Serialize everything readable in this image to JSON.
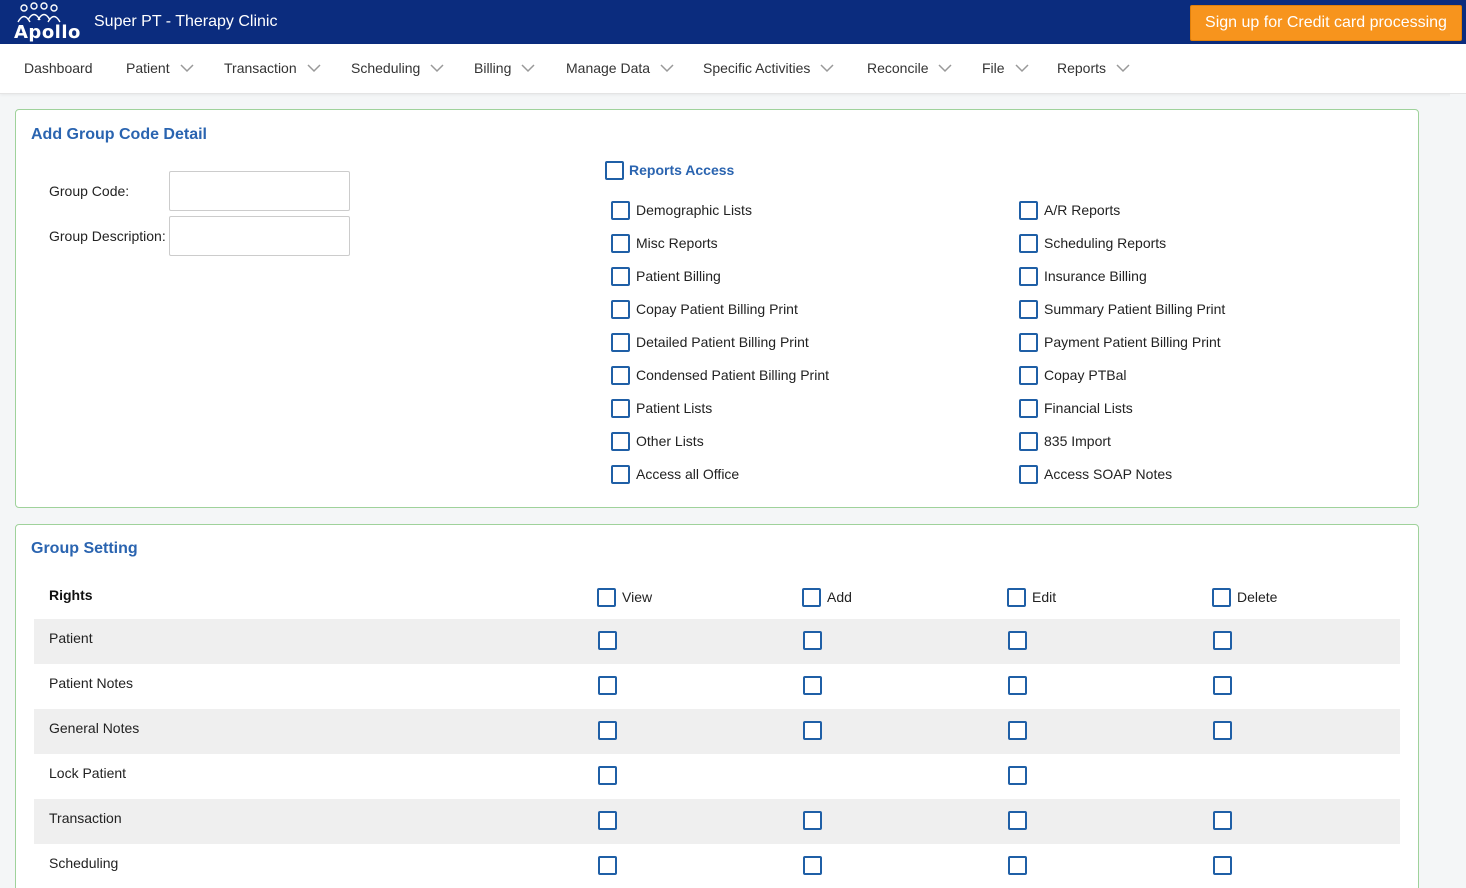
{
  "header": {
    "logo_text": "Apollo",
    "clinic_title": "Super PT - Therapy Clinic",
    "signup_label": "Sign up for Credit card processing"
  },
  "nav": {
    "items": [
      {
        "label": "Dashboard",
        "has_dropdown": false
      },
      {
        "label": "Patient",
        "has_dropdown": true
      },
      {
        "label": "Transaction",
        "has_dropdown": true
      },
      {
        "label": "Scheduling",
        "has_dropdown": true
      },
      {
        "label": "Billing",
        "has_dropdown": true
      },
      {
        "label": "Manage Data",
        "has_dropdown": true
      },
      {
        "label": "Specific Activities",
        "has_dropdown": true
      },
      {
        "label": "Reconcile",
        "has_dropdown": true
      },
      {
        "label": "File",
        "has_dropdown": true
      },
      {
        "label": "Reports",
        "has_dropdown": true
      }
    ]
  },
  "group_detail": {
    "title": "Add Group Code Detail",
    "group_code_label": "Group Code:",
    "group_code_value": "",
    "group_desc_label": "Group Description:",
    "group_desc_value": "",
    "reports_access_label": "Reports Access",
    "reports_access_checked": false,
    "left_options": [
      {
        "label": "Demographic Lists",
        "checked": false
      },
      {
        "label": "Misc Reports",
        "checked": false
      },
      {
        "label": "Patient Billing",
        "checked": false
      },
      {
        "label": "Copay Patient Billing Print",
        "checked": false
      },
      {
        "label": "Detailed Patient Billing Print",
        "checked": false
      },
      {
        "label": "Condensed Patient Billing Print",
        "checked": false
      },
      {
        "label": "Patient Lists",
        "checked": false
      },
      {
        "label": "Other Lists",
        "checked": false
      },
      {
        "label": "Access all Office",
        "checked": false
      }
    ],
    "right_options": [
      {
        "label": "A/R Reports",
        "checked": false
      },
      {
        "label": "Scheduling Reports",
        "checked": false
      },
      {
        "label": "Insurance Billing",
        "checked": false
      },
      {
        "label": "Summary Patient Billing Print",
        "checked": false
      },
      {
        "label": "Payment Patient Billing Print",
        "checked": false
      },
      {
        "label": "Copay PTBal",
        "checked": false
      },
      {
        "label": "Financial Lists",
        "checked": false
      },
      {
        "label": "835 Import",
        "checked": false
      },
      {
        "label": "Access SOAP Notes",
        "checked": false
      }
    ]
  },
  "group_setting": {
    "title": "Group Setting",
    "rights_header": "Rights",
    "columns": [
      "View",
      "Add",
      "Edit",
      "Delete"
    ],
    "rows": [
      {
        "label": "Patient",
        "has": [
          true,
          true,
          true,
          true
        ]
      },
      {
        "label": "Patient Notes",
        "has": [
          true,
          true,
          true,
          true
        ]
      },
      {
        "label": "General Notes",
        "has": [
          true,
          true,
          true,
          true
        ]
      },
      {
        "label": "Lock Patient",
        "has": [
          true,
          false,
          true,
          false
        ]
      },
      {
        "label": "Transaction",
        "has": [
          true,
          true,
          true,
          true
        ]
      },
      {
        "label": "Scheduling",
        "has": [
          true,
          true,
          true,
          true
        ]
      }
    ]
  },
  "colors": {
    "header_bg": "#0b2c7e",
    "signup_bg": "#f7941d",
    "title_blue": "#2a64b0",
    "checkbox_border": "#1f5fa6",
    "panel_border": "#9fd29b"
  }
}
